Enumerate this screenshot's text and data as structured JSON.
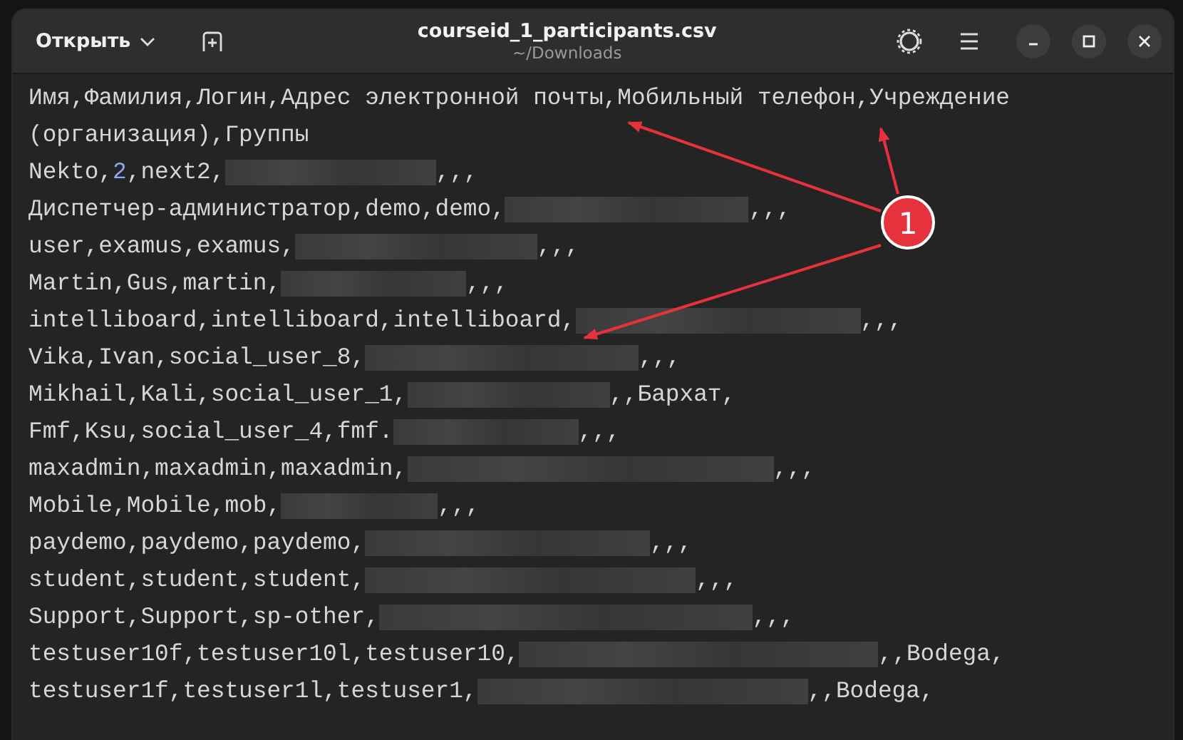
{
  "window": {
    "title": "courseid_1_participants.csv",
    "subtitle": "~/Downloads",
    "open_button": "Открыть"
  },
  "lines": [
    {
      "parts": [
        {
          "kind": "text",
          "text": "Имя,Фамилия,Логин,Адрес электронной почты,Мобильный телефон,Учреждение"
        }
      ]
    },
    {
      "parts": [
        {
          "kind": "text",
          "text": "(организация),Группы"
        }
      ]
    },
    {
      "parts": [
        {
          "kind": "text",
          "text": "Nekto,"
        },
        {
          "kind": "number",
          "text": "2"
        },
        {
          "kind": "text",
          "text": ",next2,"
        },
        {
          "kind": "redacted"
        },
        {
          "kind": "text",
          "text": ",,,"
        }
      ]
    },
    {
      "parts": [
        {
          "kind": "text",
          "text": "Диспетчер-администратор,demo,demo,"
        },
        {
          "kind": "redacted"
        },
        {
          "kind": "text",
          "text": ",,,"
        }
      ]
    },
    {
      "parts": [
        {
          "kind": "text",
          "text": "user,examus,examus,"
        },
        {
          "kind": "redacted"
        },
        {
          "kind": "text",
          "text": ",,,"
        }
      ]
    },
    {
      "parts": [
        {
          "kind": "text",
          "text": "Martin,Gus,martin,"
        },
        {
          "kind": "redacted"
        },
        {
          "kind": "text",
          "text": ",,,"
        }
      ]
    },
    {
      "parts": [
        {
          "kind": "text",
          "text": "intelliboard,intelliboard,intelliboard,"
        },
        {
          "kind": "redacted"
        },
        {
          "kind": "text",
          "text": ",,,"
        }
      ]
    },
    {
      "parts": [
        {
          "kind": "text",
          "text": "Vika,Ivan,social_user_8,"
        },
        {
          "kind": "redacted"
        },
        {
          "kind": "text",
          "text": ",,,"
        }
      ]
    },
    {
      "parts": [
        {
          "kind": "text",
          "text": "Mikhail,Kali,social_user_1,"
        },
        {
          "kind": "redacted"
        },
        {
          "kind": "text",
          "text": ",,Бархат,"
        }
      ]
    },
    {
      "parts": [
        {
          "kind": "text",
          "text": "Fmf,Ksu,social_user_4,fmf."
        },
        {
          "kind": "redacted"
        },
        {
          "kind": "text",
          "text": ",,,"
        }
      ]
    },
    {
      "parts": [
        {
          "kind": "text",
          "text": "maxadmin,maxadmin,maxadmin,"
        },
        {
          "kind": "redacted"
        },
        {
          "kind": "text",
          "text": ",,,"
        }
      ]
    },
    {
      "parts": [
        {
          "kind": "text",
          "text": "Mobile,Mobile,mob,"
        },
        {
          "kind": "redacted"
        },
        {
          "kind": "text",
          "text": ",,,"
        }
      ]
    },
    {
      "parts": [
        {
          "kind": "text",
          "text": "paydemo,paydemo,paydemo,"
        },
        {
          "kind": "redacted"
        },
        {
          "kind": "text",
          "text": ",,,"
        }
      ]
    },
    {
      "parts": [
        {
          "kind": "text",
          "text": "student,student,student,"
        },
        {
          "kind": "redacted"
        },
        {
          "kind": "text",
          "text": ",,,"
        }
      ]
    },
    {
      "parts": [
        {
          "kind": "text",
          "text": "Support,Support,sp-other,"
        },
        {
          "kind": "redacted"
        },
        {
          "kind": "text",
          "text": ",,,"
        }
      ]
    },
    {
      "parts": [
        {
          "kind": "text",
          "text": "testuser10f,testuser10l,testuser10,"
        },
        {
          "kind": "redacted"
        },
        {
          "kind": "text",
          "text": ",,Bodega,"
        }
      ]
    },
    {
      "parts": [
        {
          "kind": "text",
          "text": "testuser1f,testuser1l,testuser1,"
        },
        {
          "kind": "redacted"
        },
        {
          "kind": "text",
          "text": ",,Bodega,"
        }
      ]
    }
  ],
  "annotation": {
    "label": "1"
  }
}
